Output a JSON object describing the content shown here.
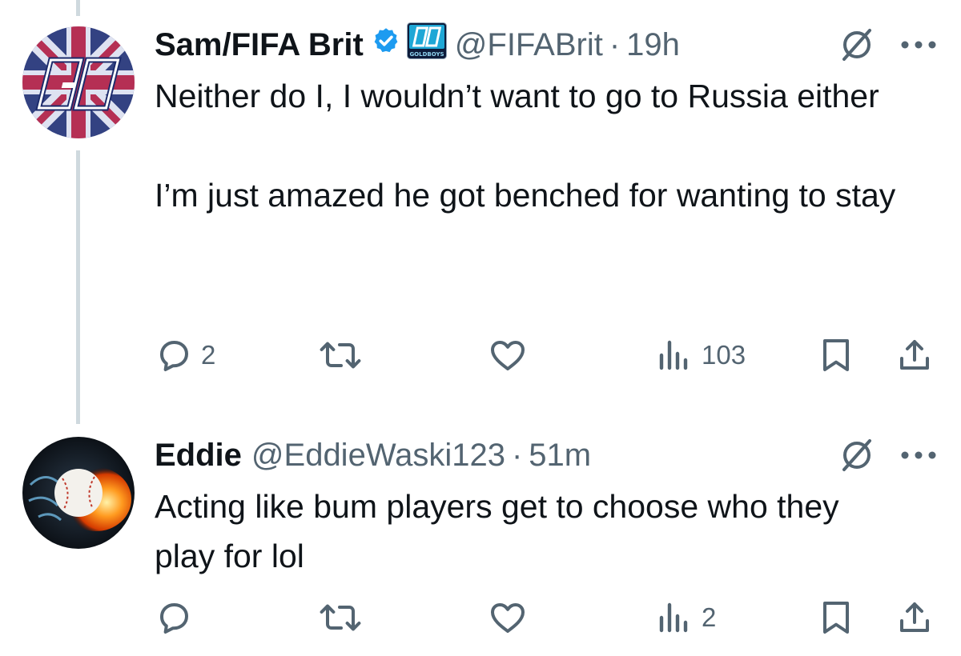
{
  "tweets": [
    {
      "display_name": "Sam/FIFA Brit",
      "verified": true,
      "affiliate_badge": "GOLDBOYS",
      "handle": "@FIFABrit",
      "separator": "·",
      "time": "19h",
      "text_paragraphs": [
        "Neither do I, I wouldn’t want to go to Russia either",
        "I’m just amazed he got benched for wanting to stay"
      ],
      "actions": {
        "replies": "2",
        "reposts": "",
        "likes": "",
        "views": "103"
      }
    },
    {
      "display_name": "Eddie",
      "verified": false,
      "handle": "@EddieWaski123",
      "separator": "·",
      "time": "51m",
      "text_paragraphs": [
        "Acting like bum players get to choose who they play for lol"
      ],
      "actions": {
        "replies": "",
        "reposts": "",
        "likes": "",
        "views": "2"
      }
    }
  ],
  "icons": {
    "reply": "reply-bubble-icon",
    "repost": "repost-arrows-icon",
    "like": "heart-icon",
    "views": "views-bar-chart-icon",
    "bookmark": "bookmark-icon",
    "share": "share-upload-icon",
    "grok": "grok-slash-icon",
    "more": "more-dots-icon",
    "verified": "verified-badge-icon"
  },
  "colors": {
    "text_primary": "#0f1419",
    "text_secondary": "#536471",
    "verified_blue": "#1d9bf0",
    "thread_line": "#cfd9de"
  }
}
